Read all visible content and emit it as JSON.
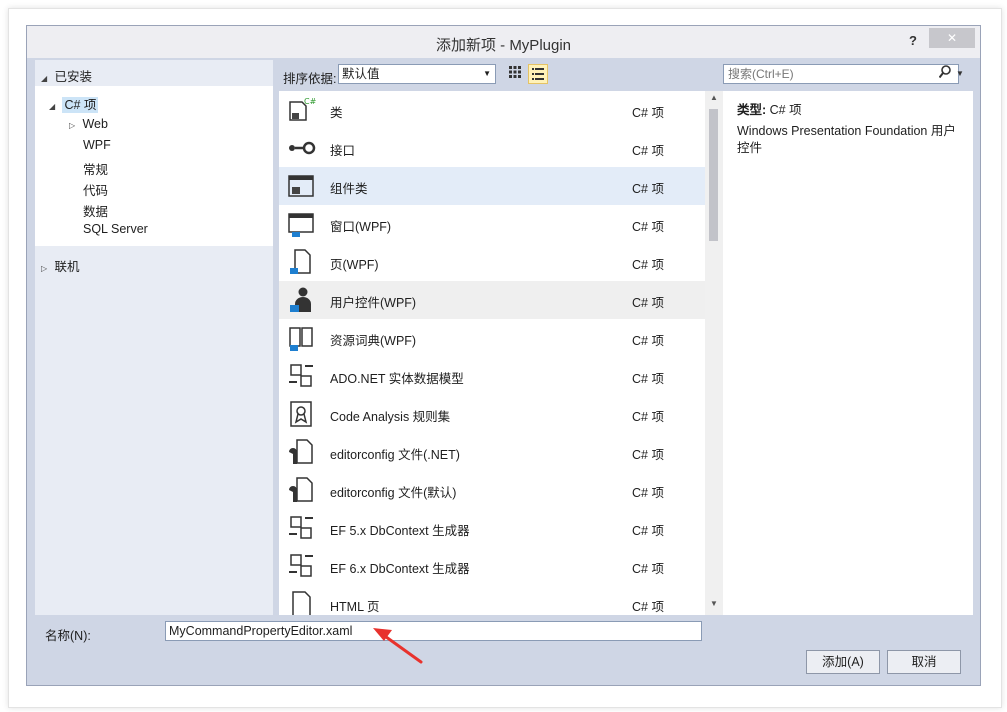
{
  "window": {
    "title": "添加新项 - MyPlugin",
    "help_glyph": "?",
    "close_glyph": "✕"
  },
  "left_tree": {
    "installed_label": "已安装",
    "csharp_label": "C# 项",
    "children": [
      "Web",
      "WPF",
      "常规",
      "代码",
      "数据",
      "SQL Server"
    ],
    "online_label": "联机"
  },
  "toolbar": {
    "sort_label": "排序依据:",
    "sort_value": "默认值",
    "search_placeholder": "搜索(Ctrl+E)"
  },
  "templates": [
    {
      "name": "类",
      "category": "C# 项",
      "icon": "class-icon"
    },
    {
      "name": "接口",
      "category": "C# 项",
      "icon": "interface-icon"
    },
    {
      "name": "组件类",
      "category": "C# 项",
      "icon": "component-class-icon"
    },
    {
      "name": "窗口(WPF)",
      "category": "C# 项",
      "icon": "wpf-window-icon"
    },
    {
      "name": "页(WPF)",
      "category": "C# 项",
      "icon": "wpf-page-icon"
    },
    {
      "name": "用户控件(WPF)",
      "category": "C# 项",
      "icon": "wpf-user-control-icon"
    },
    {
      "name": "资源词典(WPF)",
      "category": "C# 项",
      "icon": "resource-dictionary-icon"
    },
    {
      "name": "ADO.NET 实体数据模型",
      "category": "C# 项",
      "icon": "entity-model-icon"
    },
    {
      "name": "Code Analysis 规则集",
      "category": "C# 项",
      "icon": "ruleset-icon"
    },
    {
      "name": "editorconfig 文件(.NET)",
      "category": "C# 项",
      "icon": "editorconfig-icon"
    },
    {
      "name": "editorconfig 文件(默认)",
      "category": "C# 项",
      "icon": "editorconfig-icon"
    },
    {
      "name": "EF 5.x DbContext 生成器",
      "category": "C# 项",
      "icon": "dbcontext-generator-icon"
    },
    {
      "name": "EF 6.x DbContext 生成器",
      "category": "C# 项",
      "icon": "dbcontext-generator-icon"
    },
    {
      "name": "HTML 页",
      "category": "C# 项",
      "icon": "html-page-icon"
    }
  ],
  "details": {
    "type_label": "类型:",
    "type_value": "C# 项",
    "description": "Windows Presentation Foundation 用户控件"
  },
  "footer": {
    "name_label": "名称(N):",
    "name_value": "MyCommandPropertyEditor.xaml",
    "add_label": "添加(A)",
    "cancel_label": "取消"
  },
  "colors": {
    "dialog_bg": "#cfd6e5",
    "selection": "#cce4f7",
    "annotation_arrow": "#e8322d"
  }
}
